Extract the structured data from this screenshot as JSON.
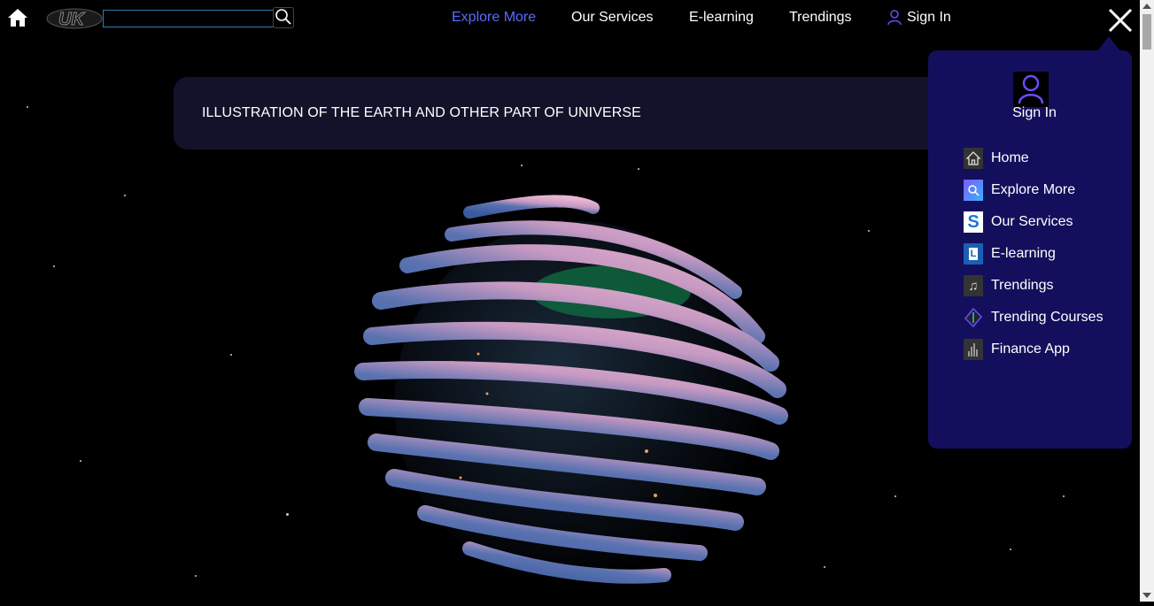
{
  "topbar": {
    "search_placeholder": "",
    "nav": [
      {
        "label": "Explore More",
        "active": true
      },
      {
        "label": "Our Services",
        "active": false
      },
      {
        "label": "E-learning",
        "active": false
      },
      {
        "label": "Trendings",
        "active": false
      }
    ],
    "signin_label": "Sign In"
  },
  "caption": {
    "text": "ILLUSTRATION OF THE EARTH AND OTHER PART OF UNIVERSE"
  },
  "menu": {
    "signin_label": "Sign In",
    "items": [
      {
        "label": "Home",
        "icon": "home-icon"
      },
      {
        "label": "Explore More",
        "icon": "explore-icon"
      },
      {
        "label": "Our Services",
        "icon": "services-icon"
      },
      {
        "label": "E-learning",
        "icon": "elearning-icon"
      },
      {
        "label": "Trendings",
        "icon": "music-note-icon"
      },
      {
        "label": "Trending Courses",
        "icon": "courses-icon"
      },
      {
        "label": "Finance App",
        "icon": "finance-icon"
      }
    ]
  },
  "colors": {
    "menu_bg": "#140f5c",
    "caption_bg": "#14122a",
    "active_nav": "#5a6bff",
    "accent_icon": "#6a4cff"
  }
}
